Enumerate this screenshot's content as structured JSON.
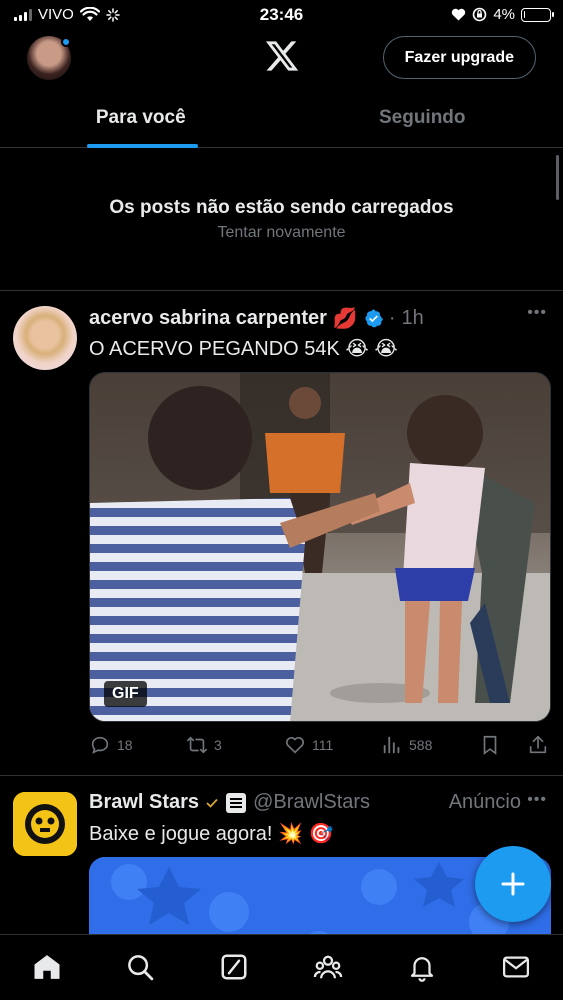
{
  "status_bar": {
    "carrier": "VIVO",
    "time": "23:46",
    "battery_text": "4%",
    "battery_level": 0.04
  },
  "header": {
    "upgrade_label": "Fazer upgrade",
    "logo_icon": "x-logo-icon",
    "avatar_has_notification": true
  },
  "tabs": [
    {
      "label": "Para você",
      "active": true
    },
    {
      "label": "Seguindo",
      "active": false
    }
  ],
  "error": {
    "title": "Os posts não estão sendo carregados",
    "retry": "Tentar novamente"
  },
  "post": {
    "author": "acervo sabrina carpenter",
    "author_emoji": "💋",
    "verified": true,
    "dot": "·",
    "time": "1h",
    "text": "O ACERVO PEGANDO 54K 😭 😭",
    "media_badge": "GIF",
    "replies": "18",
    "reposts": "3",
    "likes": "111",
    "views": "588"
  },
  "ad_post": {
    "author": "Brawl Stars",
    "handle": "@BrawlStars",
    "ad_label": "Anúncio",
    "text": "Baixe e jogue agora! 💥 🎯"
  },
  "fab": {
    "icon": "compose-plus-icon"
  },
  "bottom_nav": [
    {
      "icon": "home-icon",
      "active": true
    },
    {
      "icon": "search-icon",
      "active": false
    },
    {
      "icon": "grok-icon",
      "active": false
    },
    {
      "icon": "communities-icon",
      "active": false
    },
    {
      "icon": "notifications-icon",
      "active": false
    },
    {
      "icon": "messages-icon",
      "active": false
    }
  ],
  "colors": {
    "accent": "#1d9bf0",
    "background": "#000000",
    "text": "#e7e9ea",
    "muted": "#71767b",
    "divider": "#2f3336"
  }
}
